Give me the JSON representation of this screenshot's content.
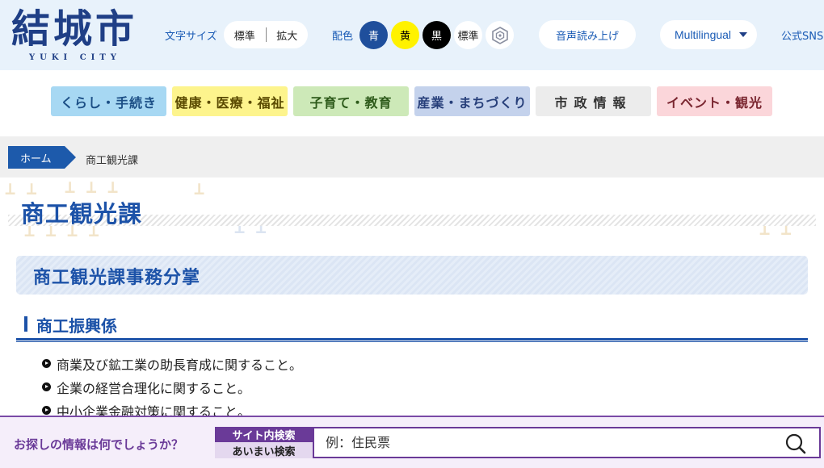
{
  "header": {
    "logo_text": "結城市",
    "logo_sub": "YUKI CITY",
    "font_size_label": "文字サイズ",
    "font_size_standard": "標準",
    "font_size_large": "拡大",
    "color_label": "配色",
    "color_options": [
      "青",
      "黄",
      "黒",
      "標準"
    ],
    "voice_button": "音声読み上げ",
    "multilingual": "Multilingual",
    "sns_link": "公式SNS"
  },
  "nav": {
    "items": [
      "くらし・手続き",
      "健康・医療・福祉",
      "子育て・教育",
      "産業・まちづくり",
      "市政情報",
      "イベント・観光"
    ]
  },
  "breadcrumb": {
    "home": "ホーム",
    "current": "商工観光課"
  },
  "main": {
    "page_title": "商工観光課",
    "section_title": "商工観光課事務分掌",
    "subsection_title": "商工振興係",
    "duties": [
      "商業及び鉱工業の助長育成に関すること。",
      "企業の経営合理化に関すること。",
      "中小企業金融対策に関すること。"
    ]
  },
  "search": {
    "question": "お探しの情報は何でしょうか？",
    "tab_site": "サイト内検索",
    "tab_fuzzy": "あいまい検索",
    "placeholder": "例：住民票"
  },
  "colors": {
    "brand_blue": "#1c52a8",
    "search_purple": "#6a3a98",
    "header_bg": "#e8f2fb"
  },
  "icons": [
    "hexagon-icon",
    "chevron-down-icon",
    "search-icon"
  ]
}
